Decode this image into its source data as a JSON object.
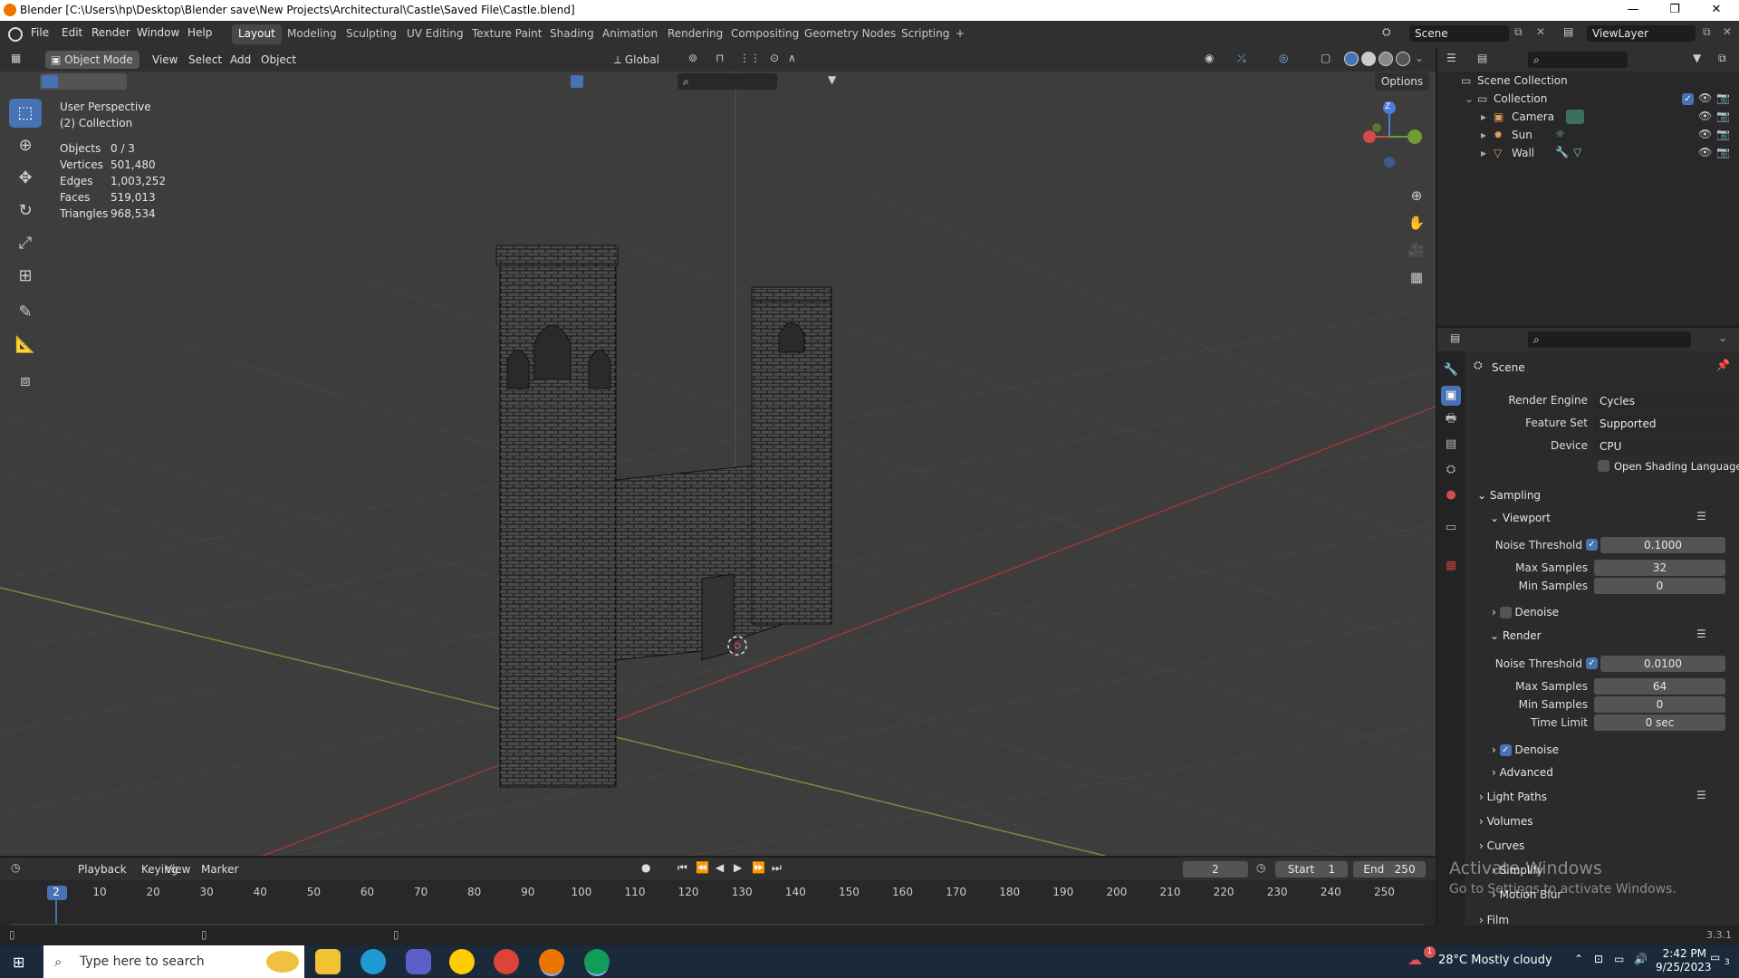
{
  "titlebar": {
    "title": "Blender [C:\\Users\\hp\\Desktop\\Blender save\\New Projects\\Architectural\\Castle\\Saved File\\Castle.blend]",
    "min": "—",
    "max": "❐",
    "close": "✕"
  },
  "menus": [
    "File",
    "Edit",
    "Render",
    "Window",
    "Help"
  ],
  "workspaces": [
    "Layout",
    "Modeling",
    "Sculpting",
    "UV Editing",
    "Texture Paint",
    "Shading",
    "Animation",
    "Rendering",
    "Compositing",
    "Geometry Nodes",
    "Scripting",
    "+"
  ],
  "scene_label": "Scene",
  "viewlayer_label": "ViewLayer",
  "header3d": {
    "mode": "Object Mode",
    "menus": [
      "View",
      "Select",
      "Add",
      "Object"
    ],
    "orientation": "Global",
    "options": "Options"
  },
  "viewport": {
    "perspective": "User Perspective",
    "collection": "(2) Collection",
    "stats": [
      {
        "label": "Objects",
        "value": "0 / 3"
      },
      {
        "label": "Vertices",
        "value": "501,480"
      },
      {
        "label": "Edges",
        "value": "1,003,252"
      },
      {
        "label": "Faces",
        "value": "519,013"
      },
      {
        "label": "Triangles",
        "value": "968,534"
      }
    ],
    "gizmo": {
      "z": "Z",
      "x": "X",
      "y": "Y"
    }
  },
  "outliner": {
    "root": "Scene Collection",
    "collection": "Collection",
    "items": [
      "Camera",
      "Sun",
      "Wall"
    ]
  },
  "properties": {
    "scene": "Scene",
    "render_engine_label": "Render Engine",
    "render_engine": "Cycles",
    "feature_set_label": "Feature Set",
    "feature_set": "Supported",
    "device_label": "Device",
    "device": "CPU",
    "osl_label": "Open Shading Language",
    "sampling": "Sampling",
    "viewport": "Viewport",
    "noise_threshold_label": "Noise Threshold",
    "vp_noise": "0.1000",
    "max_samples_label": "Max Samples",
    "vp_max": "32",
    "min_samples_label": "Min Samples",
    "vp_min": "0",
    "denoise_label": "Denoise",
    "render": "Render",
    "r_noise": "0.0100",
    "r_max": "64",
    "r_min": "0",
    "time_limit_label": "Time Limit",
    "time_limit": "0 sec",
    "advanced": "Advanced",
    "light_paths": "Light Paths",
    "volumes": "Volumes",
    "curves": "Curves",
    "simplify": "Simplify",
    "motion_blur": "Motion Blur",
    "film": "Film"
  },
  "activate": {
    "line1": "Activate Windows",
    "line2": "Go to Settings to activate Windows."
  },
  "timeline": {
    "menus": [
      "Playback",
      "Keying",
      "View",
      "Marker"
    ],
    "current_frame": "2",
    "start_label": "Start",
    "start": "1",
    "end_label": "End",
    "end": "250",
    "frames": [
      "2",
      "10",
      "20",
      "30",
      "40",
      "50",
      "60",
      "70",
      "80",
      "90",
      "100",
      "110",
      "120",
      "130",
      "140",
      "150",
      "160",
      "170",
      "180",
      "190",
      "200",
      "210",
      "220",
      "230",
      "240",
      "250"
    ]
  },
  "version": "3.3.1",
  "taskbar": {
    "search": "Type here to search",
    "temp": "28°C",
    "weather": "Mostly cloudy",
    "time": "2:42 PM",
    "date": "9/25/2023",
    "notif": "3",
    "weather_badge": "1"
  }
}
